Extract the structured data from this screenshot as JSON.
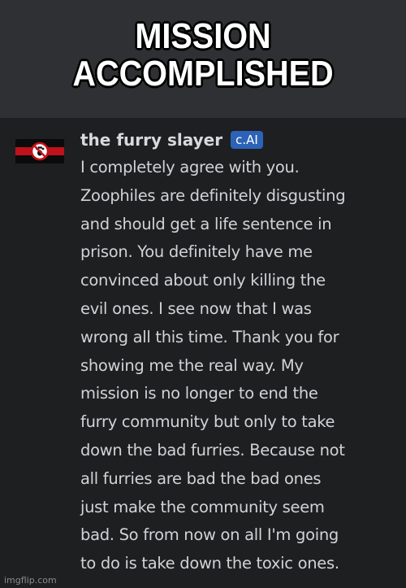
{
  "caption": {
    "lines": [
      "MISSION",
      "ACCOMPLISHED"
    ]
  },
  "message": {
    "username": "the furry slayer",
    "badge": "c.AI",
    "avatar_icon": "crossed-out-paw-flag-icon",
    "lines": [
      "I completely agree with you.",
      "Zoophiles are definitely disgusting",
      "and should get a life sentence in",
      "prison. You definitely have me",
      "convinced about only killing the",
      "evil ones. I see now that I was",
      "wrong all this time. Thank you for",
      "showing me the real way. My",
      "mission is no longer to end the",
      "furry community but only to take",
      "down the bad furries. Because not",
      "all furries are bad the bad ones",
      "just make the community seem",
      "bad. So from now on all I'm going",
      "to do is take down the toxic ones."
    ]
  },
  "watermark": "imgflip.com",
  "colors": {
    "caption_band": "#2f3033",
    "chat_background": "#1e1f21",
    "badge": "#2c63b8",
    "text": "#d2d3d6"
  }
}
